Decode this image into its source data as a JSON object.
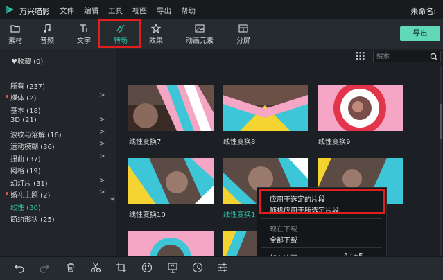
{
  "app": {
    "title": "万兴喵影",
    "document_title": "未命名:"
  },
  "menu": [
    "文件",
    "编辑",
    "工具",
    "视图",
    "导出",
    "帮助"
  ],
  "toolbar": {
    "tabs": [
      {
        "label": "素材",
        "icon": "folder-icon"
      },
      {
        "label": "音频",
        "icon": "music-note-icon"
      },
      {
        "label": "文字",
        "icon": "text-icon"
      },
      {
        "label": "转场",
        "icon": "transition-icon"
      },
      {
        "label": "效果",
        "icon": "effects-icon"
      },
      {
        "label": "动画元素",
        "icon": "image-icon"
      },
      {
        "label": "分屏",
        "icon": "split-screen-icon"
      }
    ],
    "active": "转场",
    "export_label": "导出"
  },
  "sidebar": {
    "favorites": "♥收藏 (0)",
    "categories": [
      {
        "label": "所有 (237)",
        "dot": false,
        "arrow": false
      },
      {
        "label": "媒体 (2)",
        "dot": true,
        "arrow": true
      },
      {
        "label": "基本 (18)",
        "dot": false,
        "arrow": false
      },
      {
        "label": "3D (21)",
        "dot": false,
        "arrow": true
      },
      {
        "label": "波纹与溶解 (16)",
        "dot": false,
        "arrow": true
      },
      {
        "label": "运动模糊 (36)",
        "dot": false,
        "arrow": true
      },
      {
        "label": "扭曲 (37)",
        "dot": false,
        "arrow": true
      },
      {
        "label": "网格 (19)",
        "dot": false,
        "arrow": false
      },
      {
        "label": "幻灯片 (31)",
        "dot": false,
        "arrow": true
      },
      {
        "label": "婚礼主题 (2)",
        "dot": true,
        "arrow": true
      },
      {
        "label": "线性 (30)",
        "dot": false,
        "arrow": false,
        "selected": true
      },
      {
        "label": "简约形状 (25)",
        "dot": false,
        "arrow": false
      }
    ]
  },
  "search": {
    "placeholder": "搜索"
  },
  "thumbnails": [
    {
      "label": "线性变换7"
    },
    {
      "label": "线性变换8"
    },
    {
      "label": "线性变换9"
    },
    {
      "label": "线性变换10"
    },
    {
      "label": "线性变换1",
      "selected": true
    },
    {
      "label": ""
    }
  ],
  "context_menu": {
    "items": [
      {
        "label": "应用于选定的片段"
      },
      {
        "label": "随机应用于所选定片段"
      },
      {
        "label": "现在下载",
        "disabled": true
      },
      {
        "label": "全部下载"
      },
      {
        "label": "加入收藏",
        "shortcut": "Alt+F"
      }
    ]
  },
  "colors": {
    "accent": "#34c0a6",
    "export": "#61d8b6",
    "highlight": "#e01f1f",
    "cyan": "#3cc6d8",
    "pink": "#f4a6c4",
    "yellow": "#f5d432"
  },
  "bottom_tools": [
    "undo-icon",
    "redo-icon",
    "delete-icon",
    "cut-icon",
    "crop-icon",
    "color-icon",
    "screenshot-icon",
    "timer-icon",
    "settings-icon"
  ]
}
